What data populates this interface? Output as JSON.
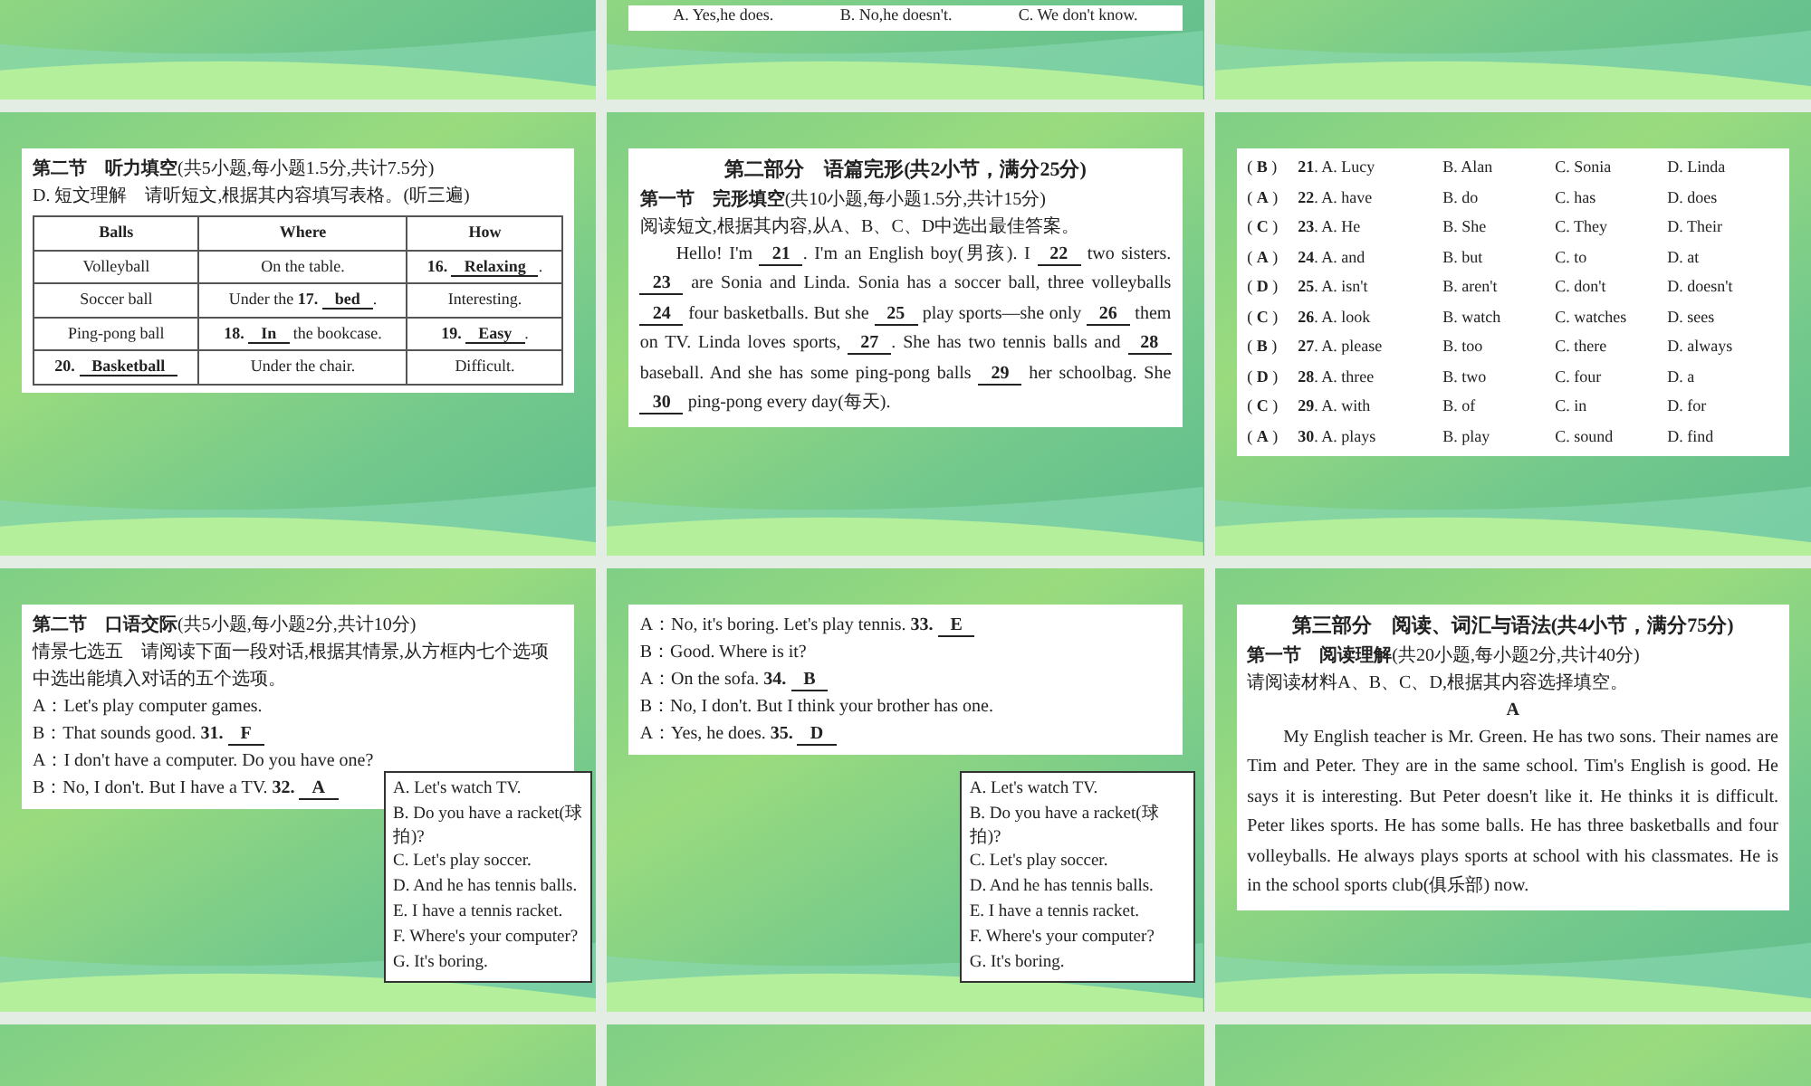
{
  "slides": [
    {
      "kind": "blank"
    },
    {
      "kind": "answer_row",
      "options": [
        "A. Yes,he does.",
        "B. No,he doesn't.",
        "C. We don't know."
      ]
    },
    {
      "kind": "blank"
    },
    {
      "kind": "table",
      "heading": "**第二节　听力填空**(共5小题,每小题1.5分,共计7.5分)",
      "instruction": "D. 短文理解　请听短文,根据其内容填写表格。(听三遍)",
      "columns": [
        "Balls",
        "Where",
        "How"
      ],
      "rows": [
        [
          "Volleyball",
          "On the table.",
          "**16.** *Relaxing*."
        ],
        [
          "Soccer ball",
          "Under the **17.** *bed*.",
          "Interesting."
        ],
        [
          "Ping-pong ball",
          "**18.** *In* the bookcase.",
          "**19.** *Easy*."
        ],
        [
          "**20.** *Basketball*",
          "Under the chair.",
          "Difficult."
        ]
      ]
    },
    {
      "kind": "cloze",
      "title": "第二部分　语篇完形(共2小节，满分25分)",
      "heading": "**第一节　完形填空**(共10小题,每小题1.5分,共计15分)",
      "instruction": "阅读短文,根据其内容,从A、B、C、D中选出最佳答案。",
      "passage": "Hello! I'm *21*. I'm an English boy(男孩). I *22* two sisters. *23* are Sonia and Linda. Sonia has a soccer ball, three volleyballs *24* four basketballs. But she *25* play sports—she only *26* them on TV. Linda loves sports, *27*. She has two tennis balls and *28* baseball. And she has some ping-pong balls *29* her schoolbag. She *30* ping-pong every day(每天)."
    },
    {
      "kind": "choices",
      "rows": [
        {
          "key": "( **B** )",
          "options": [
            "**21**. A. Lucy",
            "B. Alan",
            "C. Sonia",
            "D. Linda"
          ]
        },
        {
          "key": "( **A** )",
          "options": [
            "**22**. A. have",
            "B. do",
            "C. has",
            "D. does"
          ]
        },
        {
          "key": "( **C** )",
          "options": [
            "**23**. A. He",
            "B. She",
            "C. They",
            "D. Their"
          ]
        },
        {
          "key": "( **A** )",
          "options": [
            "**24**. A. and",
            "B. but",
            "C. to",
            "D. at"
          ]
        },
        {
          "key": "( **D** )",
          "options": [
            "**25**. A. isn't",
            "B. aren't",
            "C. don't",
            "D. doesn't"
          ]
        },
        {
          "key": "( **C** )",
          "options": [
            "**26**. A. look",
            "B. watch",
            "C. watches",
            "D. sees"
          ]
        },
        {
          "key": "( **B** )",
          "options": [
            "**27**. A. please",
            "B. too",
            "C. there",
            "D. always"
          ]
        },
        {
          "key": "( **D** )",
          "options": [
            "**28**. A. three",
            "B. two",
            "C. four",
            "D. a"
          ]
        },
        {
          "key": "( **C** )",
          "options": [
            "**29**. A. with",
            "B. of",
            "C. in",
            "D. for"
          ]
        },
        {
          "key": "( **A** )",
          "options": [
            "**30**. A. plays",
            "B. play",
            "C. sound",
            "D. find"
          ]
        }
      ]
    },
    {
      "kind": "dialogue",
      "heading": "**第二节　口语交际**(共5小题,每小题2分,共计10分)",
      "instruction": "情景七选五　请阅读下面一段对话,根据其情景,从方框内七个选项中选出能填入对话的五个选项。",
      "lines": [
        "A：Let's play computer games.",
        "B：That sounds good. **31.** *F*",
        "A：I don't have a computer. Do you have one?",
        "B：No, I don't. But I have a TV. **32.** *A*"
      ],
      "options": [
        "A. Let's watch TV.",
        "B. Do you have a racket(球拍)?",
        "C. Let's play soccer.",
        "D. And he has tennis balls.",
        "E. I have a tennis racket.",
        "F. Where's your computer?",
        "G. It's boring."
      ]
    },
    {
      "kind": "dialogue",
      "lines": [
        "A：No, it's boring. Let's play tennis. **33.** *E*",
        "B：Good. Where is it?",
        "A：On the sofa. **34.** *B*",
        "B：No, I don't. But I think your brother has one.",
        "A：Yes, he does. **35.** *D*"
      ],
      "options": [
        "A. Let's watch TV.",
        "B. Do you have a racket(球拍)?",
        "C. Let's play soccer.",
        "D. And he has tennis balls.",
        "E. I have a tennis racket.",
        "F. Where's your computer?",
        "G. It's boring."
      ]
    },
    {
      "kind": "reading",
      "title": "第三部分　阅读、词汇与语法(共4小节，满分75分)",
      "heading": "**第一节　阅读理解**(共20小题,每小题2分,共计40分)",
      "instruction": "请阅读材料A、B、C、D,根据其内容选择填空。",
      "label": "A",
      "passage": "My English teacher is Mr. Green. He has two sons. Their names are Tim and Peter. They are in the same school. Tim's English is good. He says it is interesting. But Peter doesn't like it. He thinks it is difficult. Peter likes sports. He has some balls. He has three basketballs and four volleyballs. He always plays sports at school with his classmates. He is in the school sports club(俱乐部) now."
    },
    {
      "kind": "blank"
    },
    {
      "kind": "blank"
    },
    {
      "kind": "blank"
    }
  ]
}
